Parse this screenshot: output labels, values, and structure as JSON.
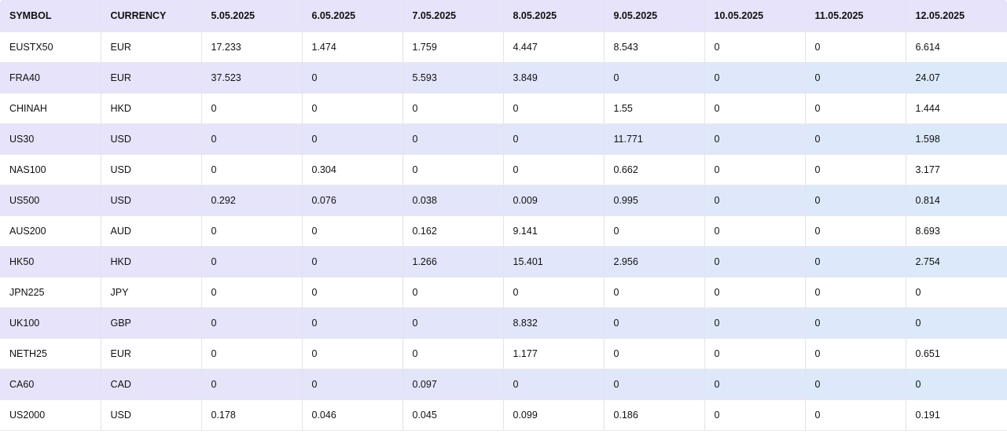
{
  "table": {
    "headers": [
      "SYMBOL",
      "CURRENCY",
      "5.05.2025",
      "6.05.2025",
      "7.05.2025",
      "8.05.2025",
      "9.05.2025",
      "10.05.2025",
      "11.05.2025",
      "12.05.2025"
    ],
    "rows": [
      [
        "EUSTX50",
        "EUR",
        "17.233",
        "1.474",
        "1.759",
        "4.447",
        "8.543",
        "0",
        "0",
        "6.614"
      ],
      [
        "FRA40",
        "EUR",
        "37.523",
        "0",
        "5.593",
        "3.849",
        "0",
        "0",
        "0",
        "24.07"
      ],
      [
        "CHINAH",
        "HKD",
        "0",
        "0",
        "0",
        "0",
        "1.55",
        "0",
        "0",
        "1.444"
      ],
      [
        "US30",
        "USD",
        "0",
        "0",
        "0",
        "0",
        "11.771",
        "0",
        "0",
        "1.598"
      ],
      [
        "NAS100",
        "USD",
        "0",
        "0.304",
        "0",
        "0",
        "0.662",
        "0",
        "0",
        "3.177"
      ],
      [
        "US500",
        "USD",
        "0.292",
        "0.076",
        "0.038",
        "0.009",
        "0.995",
        "0",
        "0",
        "0.814"
      ],
      [
        "AUS200",
        "AUD",
        "0",
        "0",
        "0.162",
        "9.141",
        "0",
        "0",
        "0",
        "8.693"
      ],
      [
        "HK50",
        "HKD",
        "0",
        "0",
        "1.266",
        "15.401",
        "2.956",
        "0",
        "0",
        "2.754"
      ],
      [
        "JPN225",
        "JPY",
        "0",
        "0",
        "0",
        "0",
        "0",
        "0",
        "0",
        "0"
      ],
      [
        "UK100",
        "GBP",
        "0",
        "0",
        "0",
        "8.832",
        "0",
        "0",
        "0",
        "0"
      ],
      [
        "NETH25",
        "EUR",
        "0",
        "0",
        "0",
        "1.177",
        "0",
        "0",
        "0",
        "0.651"
      ],
      [
        "CA60",
        "CAD",
        "0",
        "0",
        "0.097",
        "0",
        "0",
        "0",
        "0",
        "0"
      ],
      [
        "US2000",
        "USD",
        "0.178",
        "0.046",
        "0.045",
        "0.099",
        "0.186",
        "0",
        "0",
        "0.191"
      ]
    ]
  },
  "colors": {
    "header_bg": "#e6e3fb",
    "alt_row_left": "#e6e3fb",
    "alt_row_right": "#dce9fb",
    "row_bg": "#ffffff",
    "grid_line": "#e3e3ea"
  }
}
